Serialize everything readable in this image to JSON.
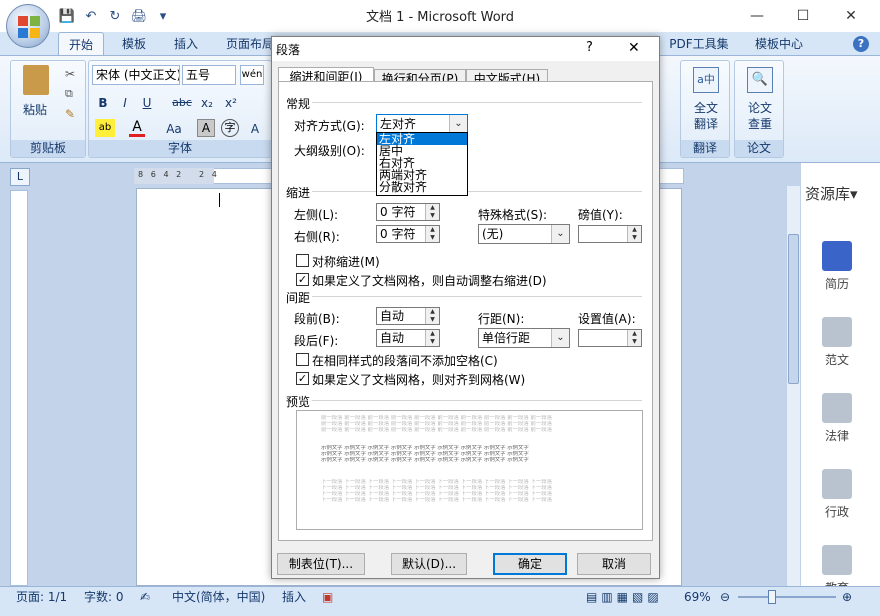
{
  "window": {
    "title": "文档 1 - Microsoft Word"
  },
  "qat": {
    "save": "💾",
    "undo": "↶",
    "redo": "↻",
    "print": "🖨",
    "more": "▾"
  },
  "ribbon_tabs": [
    "开始",
    "模板",
    "插入",
    "页面布局",
    "PDF工具集",
    "模板中心"
  ],
  "clipboard": {
    "paste": "粘贴",
    "group": "剪贴板"
  },
  "font": {
    "name": "宋体 (中文正文)",
    "size": "五号",
    "group": "字体",
    "bold": "B",
    "italic": "I",
    "underline": "U",
    "strike": "abc",
    "sub": "x₂",
    "sup": "x²",
    "aa": "Aa",
    "grow": "A"
  },
  "translate": {
    "label1": "全文",
    "label2": "翻译",
    "group": "翻译"
  },
  "paper": {
    "label1": "论文",
    "label2": "查重",
    "group": "论文"
  },
  "dialog": {
    "title": "段落",
    "help": "?",
    "close": "✕",
    "tabs": [
      "缩进和间距(I)",
      "换行和分页(P)",
      "中文版式(H)"
    ],
    "general": {
      "section": "常规",
      "align_label": "对齐方式(G):",
      "align_value": "左对齐",
      "outline_label": "大纲级别(O):",
      "align_options": [
        "左对齐",
        "居中",
        "右对齐",
        "两端对齐",
        "分散对齐"
      ]
    },
    "indent": {
      "section": "缩进",
      "left_label": "左侧(L):",
      "left_value": "0 字符",
      "right_label": "右侧(R):",
      "right_value": "0 字符",
      "special_label": "特殊格式(S):",
      "special_value": "(无)",
      "by_label": "磅值(Y):",
      "mirror": "对称缩进(M)",
      "auto_adjust": "如果定义了文档网格，则自动调整右缩进(D)"
    },
    "spacing": {
      "section": "间距",
      "before_label": "段前(B):",
      "before_value": "自动",
      "after_label": "段后(F):",
      "after_value": "自动",
      "line_label": "行距(N):",
      "line_value": "单倍行距",
      "at_label": "设置值(A):",
      "no_space": "在相同样式的段落间不添加空格(C)",
      "snap_grid": "如果定义了文档网格，则对齐到网格(W)"
    },
    "preview": {
      "section": "预览",
      "prev_text": "前一段落 前一段落 前一段落 前一段落 前一段落 前一段落 前一段落 前一段落 前一段落 前一段落",
      "sample_text": "示例文字 示例文字 示例文字 示例文字 示例文字 示例文字 示例文字 示例文字 示例文字",
      "next_text": "下一段落 下一段落 下一段落 下一段落 下一段落 下一段落 下一段落 下一段落 下一段落 下一段落"
    },
    "buttons": {
      "tabs": "制表位(T)...",
      "default": "默认(D)...",
      "ok": "确定",
      "cancel": "取消"
    }
  },
  "side_panel": {
    "title": "资源库▾",
    "items": [
      "简历",
      "范文",
      "法律",
      "行政",
      "教育"
    ]
  },
  "statusbar": {
    "page": "页面: 1/1",
    "words": "字数: 0",
    "lang": "中文(简体，中国)",
    "mode": "插入",
    "zoom": "69%"
  },
  "ruler_marks": "8   6   4   2       2   4"
}
